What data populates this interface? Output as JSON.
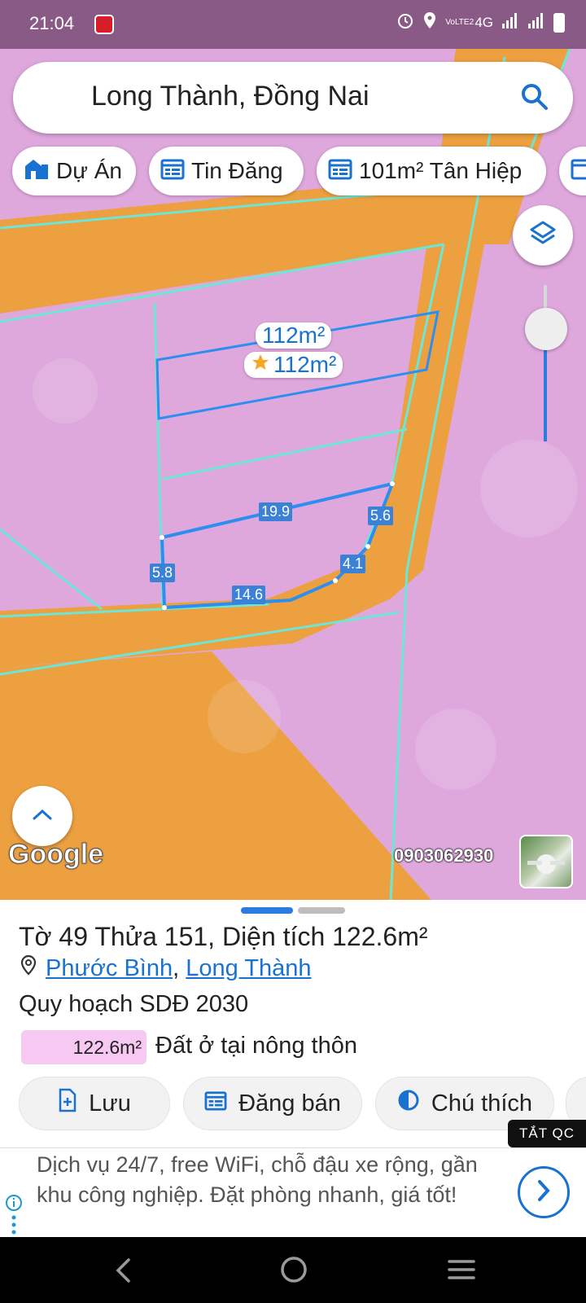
{
  "status_bar": {
    "time": "21:04",
    "network": "4G",
    "volte": "VoLTE2",
    "icons": [
      "alarm-icon",
      "location-icon",
      "signal-icon",
      "signal-icon",
      "battery-icon"
    ]
  },
  "search": {
    "query": "Long Thành, Đồng Nai",
    "icon": "search-icon"
  },
  "chips": [
    {
      "label": "Dự Án",
      "icon": "building-icon"
    },
    {
      "label": "Tin Đăng",
      "icon": "listing-icon"
    },
    {
      "label": "101m² Tân Hiệp",
      "icon": "listing-icon"
    }
  ],
  "map": {
    "area_label_1": "112m²",
    "area_label_2": "112m²",
    "edge_labels": [
      "19.9",
      "5.6",
      "4.1",
      "14.6",
      "5.8"
    ],
    "google_logo": "Google",
    "phone": "0903062930",
    "colors": {
      "residential": "#dfa8dd",
      "road_planning": "#eca040",
      "boundary": "#6ee6d6",
      "selected": "#2d8ef0"
    }
  },
  "sheet": {
    "title": "Tờ 49 Thửa 151, Diện tích 122.6m²",
    "ward": "Phước Bình",
    "separator": ",",
    "district": "Long Thành",
    "planning": "Quy hoạch SDĐ 2030",
    "land_area": "122.6m²",
    "land_type": "Đất ở tại nông thôn",
    "land_color": "#f6c8f2",
    "actions": [
      {
        "label": "Lưu",
        "icon": "save-file-icon"
      },
      {
        "label": "Đăng bán",
        "icon": "listing-icon"
      },
      {
        "label": "Chú thích",
        "icon": "legend-icon"
      }
    ]
  },
  "ad": {
    "close_label": "TẮT QC",
    "text": "Dịch vụ 24/7, free WiFi, chỗ đậu xe rộng, gần khu công nghiệp. Đặt phòng nhanh, giá tốt!"
  }
}
